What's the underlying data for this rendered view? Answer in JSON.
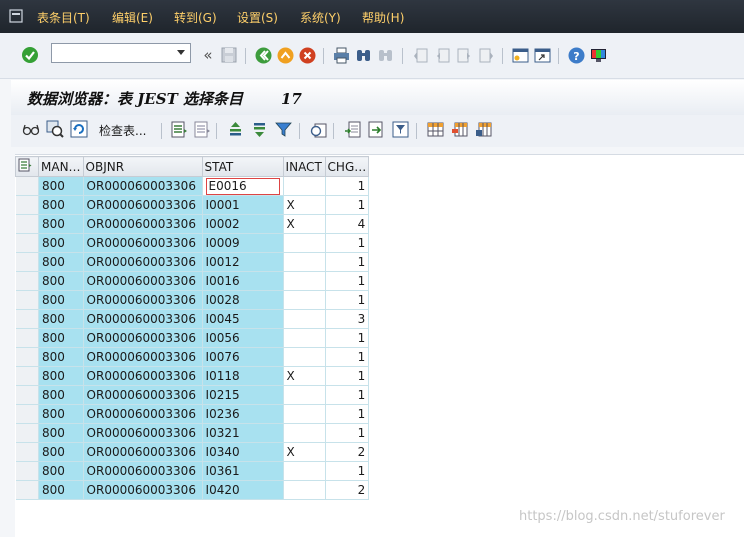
{
  "menubar": {
    "items": [
      "表条目(T)",
      "编辑(E)",
      "转到(G)",
      "设置(S)",
      "系统(Y)",
      "帮助(H)"
    ]
  },
  "toolbar": {
    "command_value": "",
    "back_glyph": "«",
    "icons": [
      "check-icon",
      "save-icon",
      "back-icon",
      "exit-icon",
      "cancel-icon",
      "print-icon",
      "find-icon",
      "find-next-icon",
      "first-page-icon",
      "prev-page-icon",
      "next-page-icon",
      "last-page-icon",
      "new-session-icon",
      "shortcut-icon",
      "help-icon",
      "customize-layout-icon"
    ]
  },
  "title": {
    "text": "数据浏览器：表 JEST 选择条目",
    "count": "17"
  },
  "app_toolbar": {
    "check_table_label": "检查表...",
    "icons": [
      "glasses-icon",
      "details-icon",
      "refresh-icon",
      "select-all-icon",
      "deselect-all-icon",
      "sort-ascending-icon",
      "sort-descending-icon",
      "filter-icon",
      "calculate-icon",
      "export-icon",
      "local-file-icon",
      "print-preview-icon",
      "layout-icon",
      "change-layout-icon",
      "save-layout-icon"
    ]
  },
  "table": {
    "columns": [
      "MAN…",
      "OBJNR",
      "STAT",
      "INACT",
      "CHG…"
    ],
    "rows": [
      [
        "800",
        "OR000060003306",
        "E0016",
        "",
        "1"
      ],
      [
        "800",
        "OR000060003306",
        "I0001",
        "X",
        "1"
      ],
      [
        "800",
        "OR000060003306",
        "I0002",
        "X",
        "4"
      ],
      [
        "800",
        "OR000060003306",
        "I0009",
        "",
        "1"
      ],
      [
        "800",
        "OR000060003306",
        "I0012",
        "",
        "1"
      ],
      [
        "800",
        "OR000060003306",
        "I0016",
        "",
        "1"
      ],
      [
        "800",
        "OR000060003306",
        "I0028",
        "",
        "1"
      ],
      [
        "800",
        "OR000060003306",
        "I0045",
        "",
        "3"
      ],
      [
        "800",
        "OR000060003306",
        "I0056",
        "",
        "1"
      ],
      [
        "800",
        "OR000060003306",
        "I0076",
        "",
        "1"
      ],
      [
        "800",
        "OR000060003306",
        "I0118",
        "X",
        "1"
      ],
      [
        "800",
        "OR000060003306",
        "I0215",
        "",
        "1"
      ],
      [
        "800",
        "OR000060003306",
        "I0236",
        "",
        "1"
      ],
      [
        "800",
        "OR000060003306",
        "I0321",
        "",
        "1"
      ],
      [
        "800",
        "OR000060003306",
        "I0340",
        "X",
        "2"
      ],
      [
        "800",
        "OR000060003306",
        "I0361",
        "",
        "1"
      ],
      [
        "800",
        "OR000060003306",
        "I0420",
        "",
        "2"
      ]
    ]
  },
  "watermark": "https://blog.csdn.net/stuforever",
  "colors": {
    "key_cell": "#a8e1f0",
    "menu_text": "#ffd06a",
    "menubar": "#2a3038"
  }
}
